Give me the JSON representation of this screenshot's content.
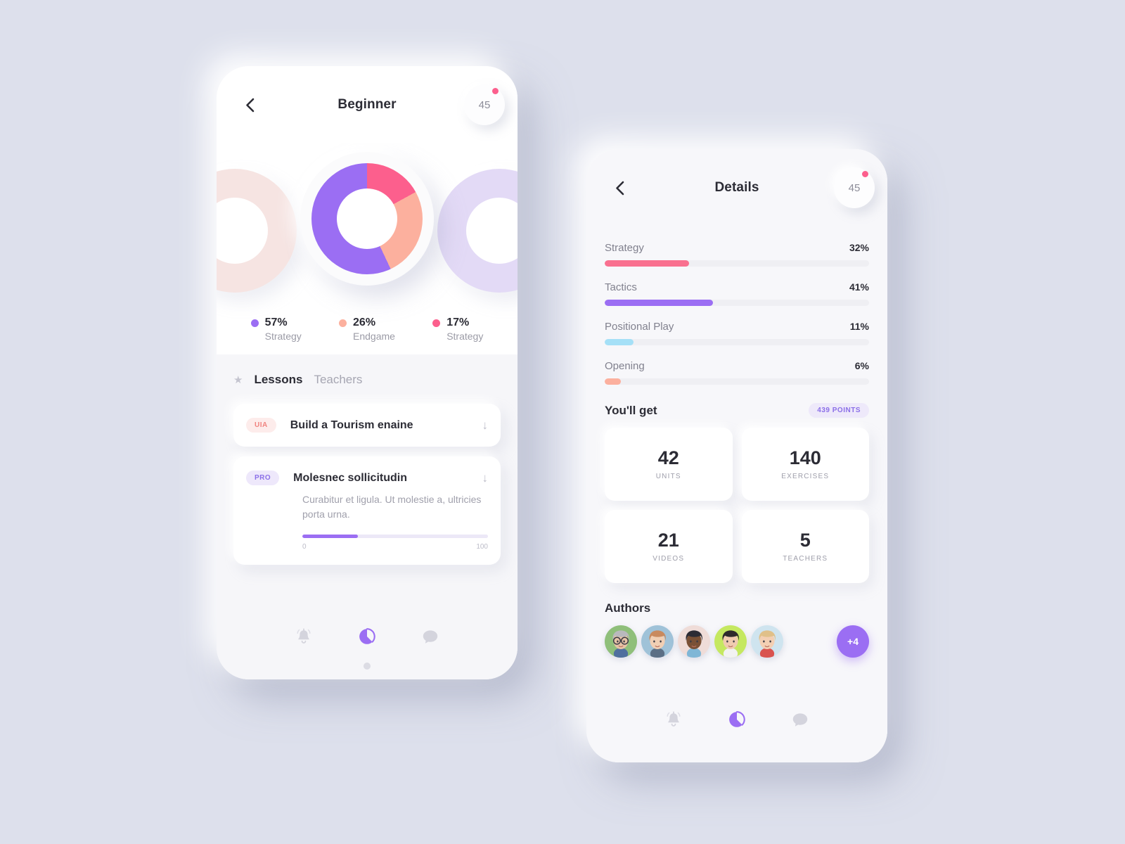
{
  "theme": {
    "bg": "#dde0ec",
    "purple": "#9b6ef3",
    "pink": "#fc5f8d",
    "salmon": "#fcb09e",
    "skyblue": "#a5e0f7",
    "text_dark": "#2c2c35",
    "text_muted": "#9b9ba6"
  },
  "phone_left": {
    "header": {
      "back_icon": "chevron-left-icon",
      "title": "Beginner",
      "points": "45",
      "notification_dot": true
    },
    "donut": {
      "type": "pie",
      "title": "Beginner skill breakdown",
      "segments": [
        {
          "label": "Strategy",
          "value": 57,
          "display": "57%",
          "color": "#9b6ef3"
        },
        {
          "label": "Endgame",
          "value": 26,
          "display": "26%",
          "color": "#fcb09e"
        },
        {
          "label": "Strategy",
          "value": 17,
          "display": "17%",
          "color": "#fc5f8d"
        }
      ],
      "side_left_color": "#f6e4e2",
      "side_right_color": "#e3daf6"
    },
    "tabs": {
      "star_icon": "star-icon",
      "items": [
        {
          "label": "Lessons",
          "active": true
        },
        {
          "label": "Teachers",
          "active": false
        }
      ]
    },
    "lessons": [
      {
        "badge": "UIA",
        "badge_style": "uia",
        "title": "Build a Tourism enaine",
        "download_icon": "download-arrow-icon",
        "description": null,
        "progress": null
      },
      {
        "badge": "PRO",
        "badge_style": "pro",
        "title": "Molesnec sollicitudin",
        "download_icon": "download-arrow-icon",
        "description": "Curabitur et ligula. Ut molestie a, ultricies porta urna.",
        "progress": {
          "percent": 30,
          "min_label": "0",
          "max_label": "100"
        }
      }
    ],
    "nav": [
      {
        "icon": "bell-icon",
        "active": false
      },
      {
        "icon": "pie-chart-icon",
        "active": true
      },
      {
        "icon": "chat-bubble-icon",
        "active": false
      }
    ]
  },
  "phone_right": {
    "header": {
      "back_icon": "chevron-left-icon",
      "title": "Details",
      "points": "45",
      "notification_dot": true
    },
    "chart_data": {
      "type": "bar",
      "title": "Details skill distribution",
      "orientation": "horizontal",
      "categories": [
        "Strategy",
        "Tactics",
        "Positional Play",
        "Opening"
      ],
      "values": [
        32,
        41,
        11,
        6
      ],
      "value_labels": [
        "32%",
        "41%",
        "11%",
        "6%"
      ],
      "colors": [
        "#f9708f",
        "#9b6ef3",
        "#a5e0f7",
        "#fcb09e"
      ],
      "xlabel": "",
      "ylabel": "",
      "xlim": [
        0,
        100
      ],
      "grid": false,
      "legend": "none"
    },
    "youll_get": {
      "title": "You'll get",
      "points_badge": "439 POINTS",
      "stats": [
        {
          "number": "42",
          "label": "UNITS"
        },
        {
          "number": "140",
          "label": "EXERCISES"
        },
        {
          "number": "21",
          "label": "VIDEOS"
        },
        {
          "number": "5",
          "label": "TEACHERS"
        }
      ]
    },
    "authors": {
      "title": "Authors",
      "avatars": [
        {
          "name": "author-1",
          "hair": "#b9b9bd",
          "skin": "#e7c3a6",
          "bg": "#8fbf7a",
          "shirt": "#4f6f9e",
          "glasses": true
        },
        {
          "name": "author-2",
          "hair": "#c98a5e",
          "skin": "#f0cfb4",
          "bg": "#9fc2d8",
          "shirt": "#5c6f85",
          "glasses": false
        },
        {
          "name": "author-3",
          "hair": "#2c2c35",
          "skin": "#7a5136",
          "bg": "#efdcd8",
          "shirt": "#7fb6d6",
          "glasses": false
        },
        {
          "name": "author-4",
          "hair": "#2e2a2c",
          "skin": "#f0cbb0",
          "bg": "#c5e860",
          "shirt": "#f2f2f2",
          "glasses": false
        },
        {
          "name": "author-5",
          "hair": "#e0c089",
          "skin": "#f3cfb3",
          "bg": "#cfe4ef",
          "shirt": "#d9534f",
          "glasses": false
        }
      ],
      "more_label": "+4"
    },
    "nav": [
      {
        "icon": "bell-icon",
        "active": false
      },
      {
        "icon": "pie-chart-icon",
        "active": true
      },
      {
        "icon": "chat-bubble-icon",
        "active": false
      }
    ]
  }
}
